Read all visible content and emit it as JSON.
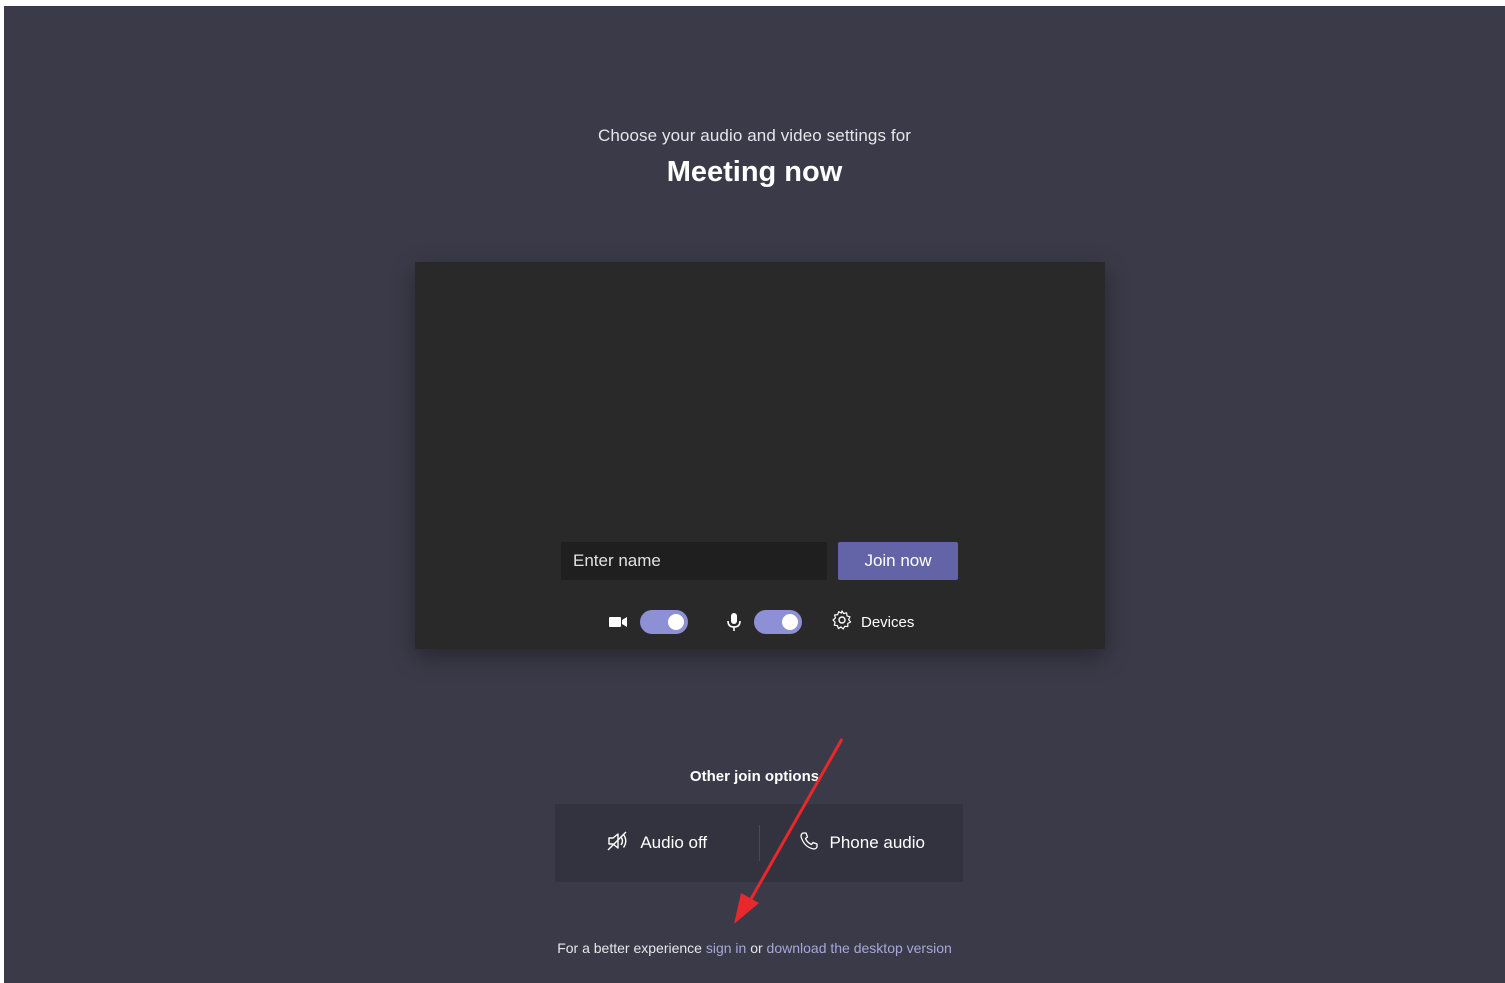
{
  "header": {
    "subtitle": "Choose your audio and video settings for",
    "meeting_title": "Meeting now"
  },
  "prejoin": {
    "name_placeholder": "Enter name",
    "join_label": "Join now",
    "camera_toggle_on": true,
    "mic_toggle_on": true,
    "devices_label": "Devices"
  },
  "other_options": {
    "heading": "Other join options",
    "audio_off_label": "Audio off",
    "phone_audio_label": "Phone audio"
  },
  "footer": {
    "prefix": "For a better experience ",
    "sign_in_link": "sign in",
    "middle": " or ",
    "download_link": "download the desktop version"
  },
  "icons": {
    "camera": "video-camera-icon",
    "mic": "microphone-icon",
    "devices": "gear-icon",
    "audio_off": "speaker-muted-icon",
    "phone": "phone-icon",
    "annotation": "red-arrow-annotation"
  },
  "colors": {
    "background": "#3b3a48",
    "preview": "#292929",
    "accent": "#6264a7",
    "toggle": "#8d90d4",
    "link": "#a6a7dc",
    "annotation_arrow": "#e8282b"
  }
}
